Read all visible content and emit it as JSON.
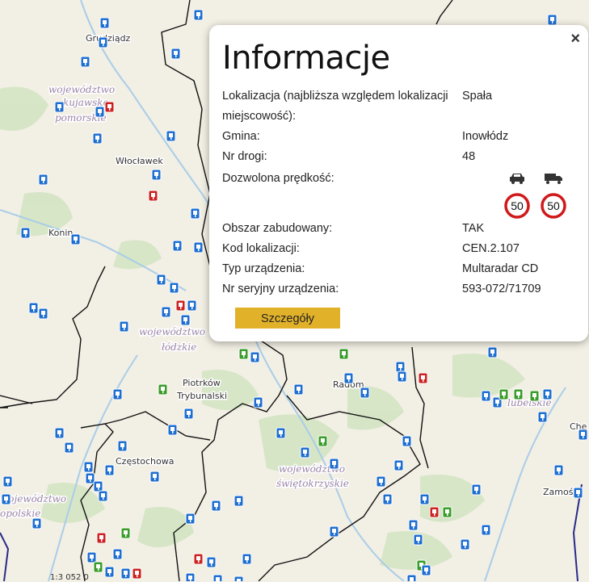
{
  "map": {
    "towns": [
      "Grudziądz",
      "Włocławek",
      "Konin",
      "Piotrków",
      "Trybunalski",
      "Radom",
      "Częstochowa",
      "Zamość",
      "Che"
    ],
    "regions": [
      "województwo",
      "kujawsko-",
      "pomorskie",
      "województwo",
      "łódzkie",
      "województwo",
      "świętokrzyskie",
      "lubelskie",
      "województwo",
      "opolskie"
    ],
    "colors": {
      "land": "#f2efe4",
      "border": "#111111",
      "river": "#a9cde8",
      "camera_blue": "#1f6fd1",
      "camera_red": "#cc2222",
      "camera_green": "#3a9c2a",
      "forest": "#cfe3bf"
    },
    "scale_text": "1:3 052 0"
  },
  "popup": {
    "title": "Informacje",
    "close_glyph": "×",
    "rows": [
      {
        "label": "Lokalizacja (najbliższa względem lokalizacji miejscowość):",
        "value": "Spała"
      },
      {
        "label": "Gmina:",
        "value": "Inowłódz"
      },
      {
        "label": "Nr drogi:",
        "value": "48"
      },
      {
        "label": "Dozwolona prędkość:",
        "value": ""
      },
      {
        "label": "Obszar zabudowany:",
        "value": "TAK"
      },
      {
        "label": "Kod lokalizacji:",
        "value": "CEN.2.107"
      },
      {
        "label": "Typ urządzenia:",
        "value": "Multaradar CD"
      },
      {
        "label": "Nr seryjny urządzenia:",
        "value": "593-072/71709"
      }
    ],
    "speed": {
      "car_icon": "car-icon",
      "truck_icon": "truck-icon",
      "car_limit": "50",
      "truck_limit": "50"
    },
    "button_label": "Szczegóły"
  }
}
